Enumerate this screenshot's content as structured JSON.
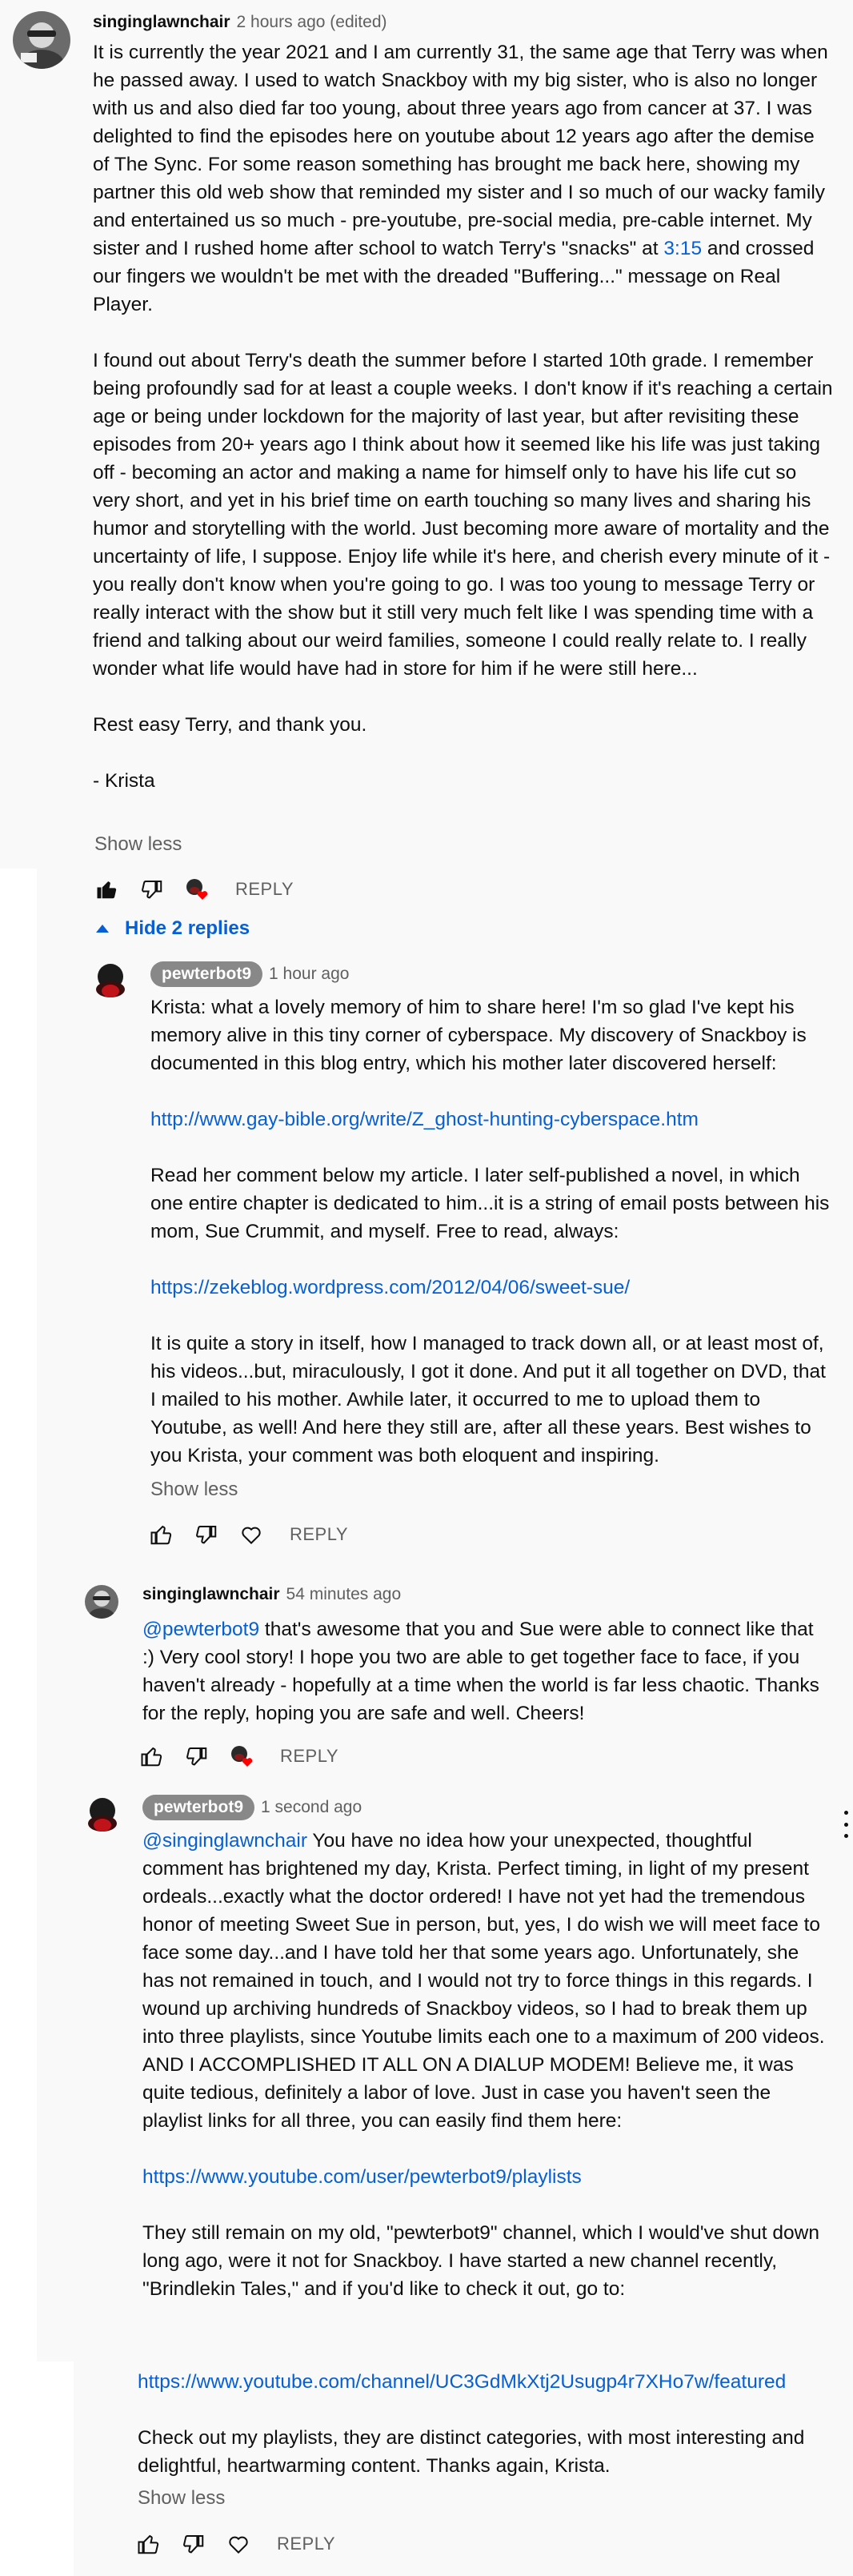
{
  "colors": {
    "background_panel": "#f9f9f9",
    "link": "#065fd4",
    "meta_text": "#606060",
    "chip": "#888888"
  },
  "comment1": {
    "author": "singinglawnchair",
    "time": "2 hours ago (edited)",
    "p1_a": "It is currently the year 2021 and I am currently 31, the same age that Terry was when he passed away. I used to watch Snackboy with my big sister, who is also no longer with us and also died far too young, about three years ago from cancer at 37. I was delighted to find the episodes here on youtube about 12 years ago after the demise of The Sync. For some reason something has brought me back here, showing my partner this old web show that reminded my sister and I so much of our wacky family and entertained us so much - pre-youtube, pre-social media, pre-cable internet. My sister and I rushed home after school to watch Terry's \"snacks\" at ",
    "p1_time_link": "3:15",
    "p1_b": " and crossed our fingers we wouldn't be met with the dreaded \"Buffering...\" message on Real Player.",
    "p2": "I found out about Terry's death the summer before I started 10th grade. I remember being profoundly sad for at least a couple weeks. I don't know if it's reaching a certain age or being under lockdown for the majority of last year, but after revisiting these episodes from 20+ years ago I think about how it seemed like his life was just taking off - becoming an actor and making a name for himself only to have his life cut so very short, and yet in his brief time on earth touching so many lives and sharing his humor and storytelling with the world. Just becoming more aware of mortality and the uncertainty of life, I suppose. Enjoy life while it's here, and cherish every minute of it - you really don't know when you're going to go. I was too young to message Terry or really interact with the show but it still very much felt like I was spending time with a friend and talking about our weird families, someone I could really relate to. I really wonder what life would have had in store for him if he were still here...",
    "p3": "Rest easy Terry, and thank you.",
    "p4": "- Krista",
    "show_less": "Show less",
    "reply": "REPLY"
  },
  "replies_toggle": "Hide 2 replies",
  "reply1": {
    "author": "pewterbot9",
    "time": "1 hour ago",
    "p1": "Krista: what a lovely memory of him to share here! I'm so glad I've kept his memory alive in this tiny corner of cyberspace. My discovery of Snackboy is documented in this blog entry, which his mother later discovered herself:",
    "link1": "http://www.gay-bible.org/write/Z_ghost-hunting-cyberspace.htm",
    "p2": "Read her comment below my article. I later self-published a novel, in which one entire chapter is dedicated to him...it is a string of email posts between his mom, Sue Crummit, and myself. Free to read, always:",
    "link2": "https://zekeblog.wordpress.com/2012/04/06/sweet-sue/",
    "p3": "It is quite a story in itself, how I managed to track down all, or at least most of, his videos...but, miraculously, I got it done. And put it all together on DVD, that I mailed to his mother. Awhile later, it occurred to me to upload them to Youtube, as well! And here they still are, after all these years. Best wishes to you Krista, your comment was both eloquent and inspiring.",
    "show_less": "Show less",
    "reply": "REPLY"
  },
  "reply2": {
    "author": "singinglawnchair",
    "time": "54 minutes ago",
    "mention": "@pewterbot9",
    "text": " that's awesome that you and Sue were able to connect like that :) Very cool story! I hope you two are able to get together face to face, if you haven't already - hopefully at a time when the world is far less chaotic. Thanks for the reply, hoping you are safe and well. Cheers!",
    "reply": "REPLY"
  },
  "reply3": {
    "author": "pewterbot9",
    "time": "1 second ago",
    "mention": "@singinglawnchair",
    "p1": "  You have no idea how your unexpected, thoughtful comment has brightened my day, Krista. Perfect timing, in light of my present ordeals...exactly what the doctor ordered! I have not yet had the tremendous honor of meeting Sweet Sue in person, but, yes, I do wish we will meet face to face some day...and I have told her that some years ago. Unfortunately, she has not remained in touch, and I would not try to force things in this regards. I wound up archiving hundreds of Snackboy videos, so I had to break them up into three playlists, since Youtube limits each one to a maximum of 200 videos. AND I ACCOMPLISHED IT ALL ON A DIALUP MODEM! Believe me, it was quite tedious, definitely a labor of love. Just in case you haven't seen the playlist links for all three, you can easily find them here:",
    "link1": "https://www.youtube.com/user/pewterbot9/playlists",
    "p2": "They still remain on my old, \"pewterbot9\" channel, which I would've shut down long ago, were it not for Snackboy. I have started a new channel recently, \"Brindlekin Tales,\" and if you'd like to check it out, go to:",
    "link2": "https://www.youtube.com/channel/UC3GdMkXtj2Usugp4r7XHo7w/featured",
    "p3": "Check out my playlists,  they are distinct categories, with most interesting and delightful, heartwarming content. Thanks again, Krista.",
    "show_less": "Show less",
    "reply": "REPLY"
  }
}
